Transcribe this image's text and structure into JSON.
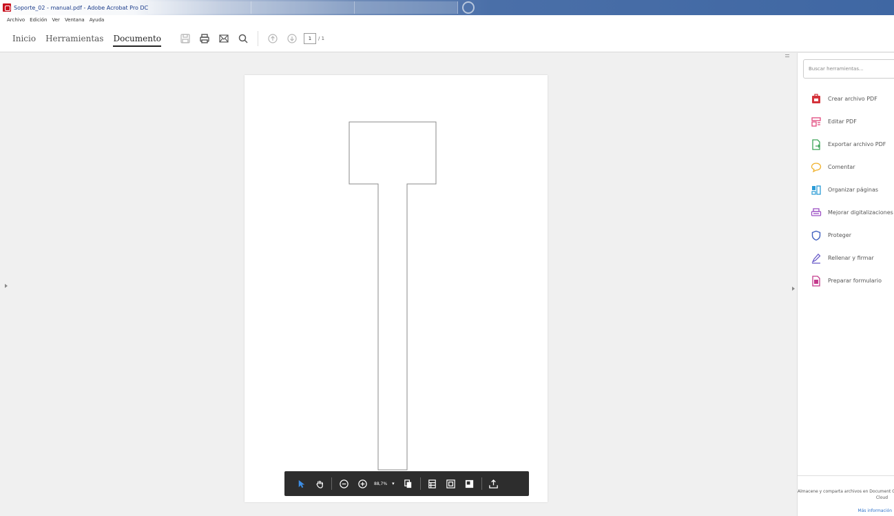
{
  "window": {
    "title": "Soporte_02 - manual.pdf - Adobe Acrobat Pro DC"
  },
  "menu": {
    "items": [
      "Archivo",
      "Edición",
      "Ver",
      "Ventana",
      "Ayuda"
    ]
  },
  "toolbar": {
    "tabs": [
      "Inicio",
      "Herramientas",
      "Documento"
    ],
    "active_tab": "Documento",
    "page_number": "1",
    "page_total": "/ 1"
  },
  "bottom_toolbar": {
    "zoom": "88,7%"
  },
  "tools_panel": {
    "search_placeholder": "Buscar herramientas...",
    "items": [
      {
        "label": "Crear archivo PDF",
        "icon": "create-pdf-icon",
        "color": "#d4333b"
      },
      {
        "label": "Editar PDF",
        "icon": "edit-pdf-icon",
        "color": "#e0457b"
      },
      {
        "label": "Exportar archivo PDF",
        "icon": "export-pdf-icon",
        "color": "#3aa356"
      },
      {
        "label": "Comentar",
        "icon": "comment-icon",
        "color": "#f0b12c"
      },
      {
        "label": "Organizar páginas",
        "icon": "organize-pages-icon",
        "color": "#2a9bd6"
      },
      {
        "label": "Mejorar digitalizaciones",
        "icon": "scan-icon",
        "color": "#9b4fc4"
      },
      {
        "label": "Proteger",
        "icon": "shield-icon",
        "color": "#3e5fbf"
      },
      {
        "label": "Rellenar y firmar",
        "icon": "fill-sign-icon",
        "color": "#6b5dc9"
      },
      {
        "label": "Preparar formulario",
        "icon": "prepare-form-icon",
        "color": "#c33a8c"
      }
    ],
    "promo_line1": "Almacene y comparta archivos en Document Cloud",
    "promo_line2": "Cloud",
    "promo_link": "Más información"
  }
}
